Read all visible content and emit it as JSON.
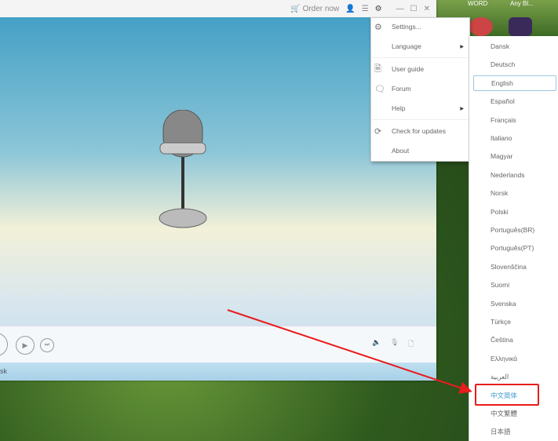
{
  "desktop": {
    "labels": [
      "WORD",
      "Any Bl..."
    ]
  },
  "titlebar": {
    "order_label": "Order now"
  },
  "status": {
    "text": "sk"
  },
  "menu": {
    "items": [
      {
        "label": "Settings...",
        "icon": "gear-icon"
      },
      {
        "label": "Language",
        "submenu": true
      },
      {
        "label": "User guide",
        "icon": "document-icon"
      },
      {
        "label": "Forum",
        "icon": "chat-icon"
      },
      {
        "label": "Help",
        "submenu": true
      },
      {
        "label": "Check for updates",
        "icon": "refresh-icon"
      },
      {
        "label": "About"
      }
    ]
  },
  "languages": {
    "selected": "English",
    "highlighted": "中文简体",
    "items": [
      "Dansk",
      "Deutsch",
      "English",
      "Español",
      "Français",
      "Italiano",
      "Magyar",
      "Nederlands",
      "Norsk",
      "Polski",
      "Português(BR)",
      "Português(PT)",
      "Slovenščina",
      "Suomi",
      "Svenska",
      "Türkçe",
      "Čeština",
      "Ελληνικά",
      "العربية",
      "中文简体",
      "中文繁體",
      "日本語"
    ]
  },
  "colors": {
    "annotation": "#e81c1c",
    "accent": "#3a9ad0"
  }
}
